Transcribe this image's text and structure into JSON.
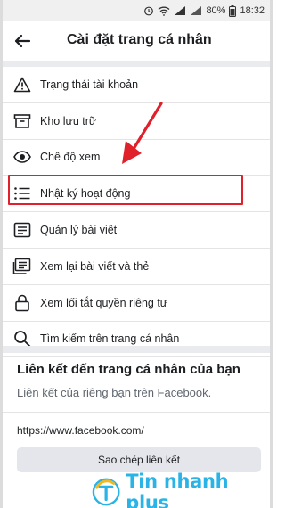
{
  "status_bar": {
    "battery": "80%",
    "time": "18:32"
  },
  "header": {
    "title": "Cài đặt trang cá nhân"
  },
  "menu": {
    "items": [
      {
        "label": "Trạng thái tài khoản",
        "icon": "warning-icon"
      },
      {
        "label": "Kho lưu trữ",
        "icon": "archive-icon"
      },
      {
        "label": "Chế độ xem",
        "icon": "eye-icon"
      },
      {
        "label": "Nhật ký hoạt động",
        "icon": "list-icon"
      },
      {
        "label": "Quản lý bài viết",
        "icon": "manage-posts-icon"
      },
      {
        "label": "Xem lại bài viết và thẻ",
        "icon": "review-posts-icon"
      },
      {
        "label": "Xem lối tắt quyền riêng tư",
        "icon": "lock-icon"
      },
      {
        "label": "Tìm kiếm trên trang cá nhân",
        "icon": "search-icon"
      }
    ],
    "highlighted_index": 3
  },
  "link_section": {
    "title": "Liên kết đến trang cá nhân của bạn",
    "subtitle": "Liên kết của riêng bạn trên Facebook.",
    "url": "https://www.facebook.com/",
    "copy_button_label": "Sao chép liên kết"
  },
  "watermark": {
    "text": "Tin nhanh plus"
  },
  "colors": {
    "highlight": "#e0202a",
    "watermark": "#29b3e6",
    "button_bg": "#e4e6eb"
  }
}
